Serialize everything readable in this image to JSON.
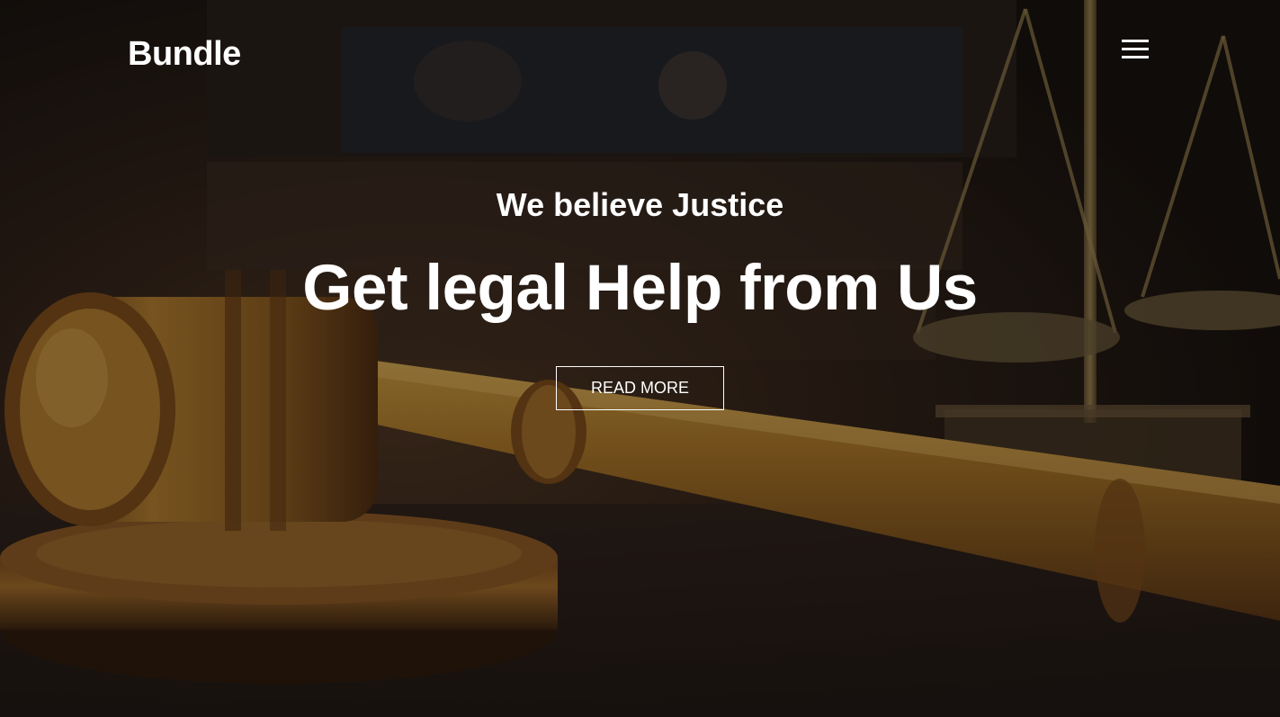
{
  "header": {
    "brand": "Bundle",
    "menu_icon": "hamburger-menu-icon"
  },
  "hero": {
    "background_image": "gavel-and-scales-of-justice-photo",
    "eyebrow": "We believe Justice",
    "headline": "Get legal Help from Us",
    "cta_label": "READ MORE"
  },
  "colors": {
    "text": "#ffffff",
    "overlay": "#0c0a09",
    "wood_light": "#b8862e",
    "wood_dark": "#3a220e"
  }
}
